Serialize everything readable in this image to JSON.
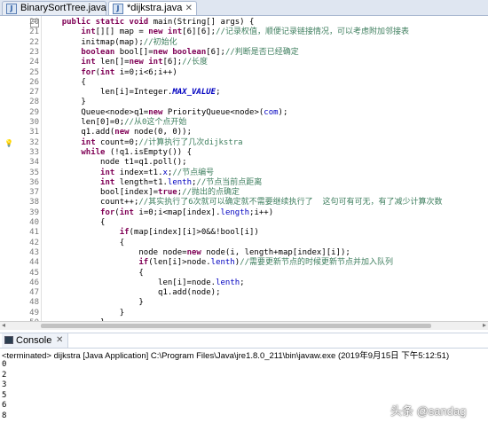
{
  "tabs": [
    {
      "label": "BinarySortTree.java",
      "active": false
    },
    {
      "label": "*dijkstra.java",
      "active": true
    }
  ],
  "editor": {
    "lines": [
      {
        "n": "20",
        "marker": "fold",
        "parts": [
          {
            "t": "    "
          },
          {
            "t": "public static void ",
            "c": "kw"
          },
          {
            "t": "main(String[] args) {"
          }
        ]
      },
      {
        "n": "21",
        "parts": [
          {
            "t": "        "
          },
          {
            "t": "int",
            "c": "kw"
          },
          {
            "t": "[][] map = "
          },
          {
            "t": "new int",
            "c": "kw"
          },
          {
            "t": "[6][6];"
          },
          {
            "t": "//记录权值，顺便记录链接情况，可以考虑附加邻接表",
            "c": "cm"
          }
        ]
      },
      {
        "n": "22",
        "parts": [
          {
            "t": "        initmap(map);"
          },
          {
            "t": "//初始化",
            "c": "cm"
          }
        ]
      },
      {
        "n": "23",
        "parts": [
          {
            "t": "        "
          },
          {
            "t": "boolean ",
            "c": "kw"
          },
          {
            "t": "bool[]="
          },
          {
            "t": "new boolean",
            "c": "kw"
          },
          {
            "t": "[6];"
          },
          {
            "t": "//判断是否已经确定",
            "c": "cm"
          }
        ]
      },
      {
        "n": "24",
        "parts": [
          {
            "t": "        "
          },
          {
            "t": "int ",
            "c": "kw"
          },
          {
            "t": "len[]="
          },
          {
            "t": "new int",
            "c": "kw"
          },
          {
            "t": "[6];"
          },
          {
            "t": "//长度",
            "c": "cm"
          }
        ]
      },
      {
        "n": "25",
        "parts": [
          {
            "t": "        "
          },
          {
            "t": "for",
            "c": "kw"
          },
          {
            "t": "("
          },
          {
            "t": "int ",
            "c": "kw"
          },
          {
            "t": "i=0;i<6;i++)"
          }
        ]
      },
      {
        "n": "26",
        "parts": [
          {
            "t": "        {"
          }
        ]
      },
      {
        "n": "27",
        "parts": [
          {
            "t": "            len[i]=Integer."
          },
          {
            "t": "MAX_VALUE",
            "c": "cst"
          },
          {
            "t": ";"
          }
        ]
      },
      {
        "n": "28",
        "parts": [
          {
            "t": "        }"
          }
        ]
      },
      {
        "n": "29",
        "parts": [
          {
            "t": "        Queue<node>q1="
          },
          {
            "t": "new ",
            "c": "kw"
          },
          {
            "t": "PriorityQueue<node>("
          },
          {
            "t": "com",
            "c": "fld"
          },
          {
            "t": ");"
          }
        ]
      },
      {
        "n": "30",
        "parts": [
          {
            "t": "        len[0]=0;"
          },
          {
            "t": "//从0这个点开始",
            "c": "cm"
          }
        ]
      },
      {
        "n": "31",
        "parts": [
          {
            "t": "        q1.add("
          },
          {
            "t": "new ",
            "c": "kw"
          },
          {
            "t": "node(0, 0));"
          }
        ]
      },
      {
        "n": "32",
        "marker": "bp",
        "parts": [
          {
            "t": "        "
          },
          {
            "t": "int ",
            "c": "kw"
          },
          {
            "t": "count=0;"
          },
          {
            "t": "//计算执行了几次dijkstra",
            "c": "cm"
          }
        ]
      },
      {
        "n": "33",
        "parts": [
          {
            "t": "        "
          },
          {
            "t": "while ",
            "c": "kw"
          },
          {
            "t": "(!q1.isEmpty()) {"
          }
        ]
      },
      {
        "n": "34",
        "parts": [
          {
            "t": "            node t1=q1.poll();"
          }
        ]
      },
      {
        "n": "35",
        "parts": [
          {
            "t": "            "
          },
          {
            "t": "int ",
            "c": "kw"
          },
          {
            "t": "index=t1."
          },
          {
            "t": "x",
            "c": "fld"
          },
          {
            "t": ";"
          },
          {
            "t": "//节点编号",
            "c": "cm"
          }
        ]
      },
      {
        "n": "36",
        "parts": [
          {
            "t": "            "
          },
          {
            "t": "int ",
            "c": "kw"
          },
          {
            "t": "length=t1."
          },
          {
            "t": "lenth",
            "c": "fld"
          },
          {
            "t": ";"
          },
          {
            "t": "//节点当前点距离",
            "c": "cm"
          }
        ]
      },
      {
        "n": "37",
        "parts": [
          {
            "t": "            bool[index]="
          },
          {
            "t": "true",
            "c": "kw"
          },
          {
            "t": ";"
          },
          {
            "t": "//抛出的点确定",
            "c": "cm"
          }
        ]
      },
      {
        "n": "38",
        "parts": [
          {
            "t": "            count++;"
          },
          {
            "t": "//其实执行了6次就可以确定就不需要继续执行了  这句可有可无，有了减少计算次数",
            "c": "cm"
          }
        ]
      },
      {
        "n": "39",
        "parts": [
          {
            "t": "            "
          },
          {
            "t": "for",
            "c": "kw"
          },
          {
            "t": "("
          },
          {
            "t": "int ",
            "c": "kw"
          },
          {
            "t": "i=0;i<map[index]."
          },
          {
            "t": "length",
            "c": "fld"
          },
          {
            "t": ";i++)"
          }
        ]
      },
      {
        "n": "40",
        "parts": [
          {
            "t": "            {"
          }
        ]
      },
      {
        "n": "41",
        "parts": [
          {
            "t": "                "
          },
          {
            "t": "if",
            "c": "kw"
          },
          {
            "t": "(map[index][i]>0&&!bool[i])"
          }
        ]
      },
      {
        "n": "42",
        "parts": [
          {
            "t": "                {"
          }
        ]
      },
      {
        "n": "43",
        "parts": [
          {
            "t": "                    node node="
          },
          {
            "t": "new ",
            "c": "kw"
          },
          {
            "t": "node(i, length+map[index][i]);"
          }
        ]
      },
      {
        "n": "44",
        "parts": [
          {
            "t": "                    "
          },
          {
            "t": "if",
            "c": "kw"
          },
          {
            "t": "(len[i]>node."
          },
          {
            "t": "lenth",
            "c": "fld"
          },
          {
            "t": ")"
          },
          {
            "t": "//需要更新节点的时候更新节点并加入队列",
            "c": "cm"
          }
        ]
      },
      {
        "n": "45",
        "parts": [
          {
            "t": "                    {"
          }
        ]
      },
      {
        "n": "46",
        "parts": [
          {
            "t": "                        len[i]=node."
          },
          {
            "t": "lenth",
            "c": "fld"
          },
          {
            "t": ";"
          }
        ]
      },
      {
        "n": "47",
        "parts": [
          {
            "t": "                        q1.add(node);"
          }
        ]
      },
      {
        "n": "48",
        "parts": [
          {
            "t": "                    }"
          }
        ]
      },
      {
        "n": "49",
        "parts": [
          {
            "t": "                }"
          }
        ]
      },
      {
        "n": "50",
        "parts": [
          {
            "t": "            }"
          }
        ]
      },
      {
        "n": "51",
        "parts": [
          {
            "t": "        }"
          }
        ]
      },
      {
        "n": "52",
        "parts": [
          {
            "t": "        "
          },
          {
            "t": "for",
            "c": "kw"
          },
          {
            "t": "("
          },
          {
            "t": "int ",
            "c": "kw"
          },
          {
            "t": "i=0;i<6;i++)"
          }
        ]
      }
    ]
  },
  "console": {
    "tab_label": "Console",
    "status": "<terminated> dijkstra [Java Application] C:\\Program Files\\Java\\jre1.8.0_211\\bin\\javaw.exe (2019年9月15日 下午5:12:51)",
    "output": [
      "0",
      "2",
      "3",
      "5",
      "6",
      "8"
    ]
  },
  "watermark": "头条 @sandag",
  "colors": {
    "keyword": "#7f0055",
    "comment": "#3f7f5f",
    "field": "#0000c0"
  }
}
